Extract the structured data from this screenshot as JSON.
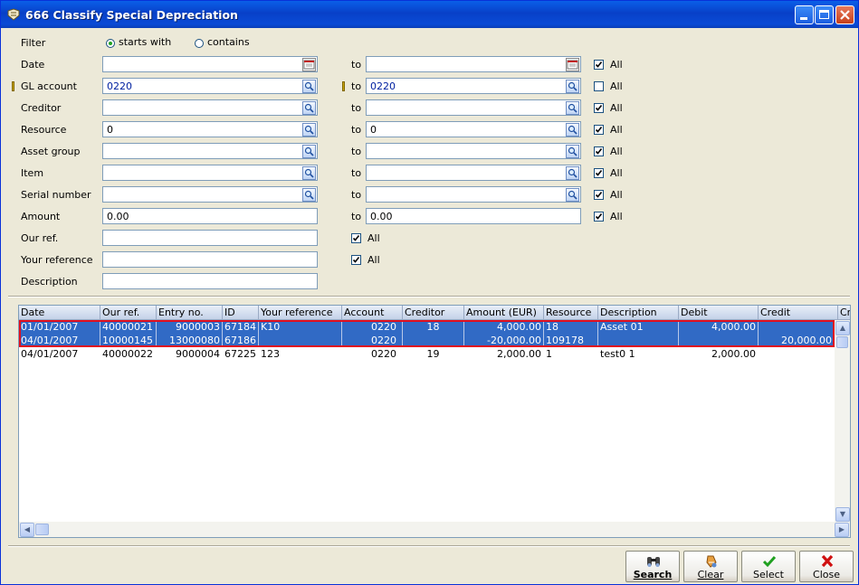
{
  "window": {
    "title": "666 Classify Special Depreciation"
  },
  "filter": {
    "label": "Filter",
    "option_starts_with": "starts with",
    "option_contains": "contains",
    "selected": "starts with"
  },
  "fields": {
    "to_label": "to",
    "all_label": "All",
    "date": {
      "label": "Date",
      "from": "",
      "to": "",
      "all": true
    },
    "gl_account": {
      "label": "GL account",
      "from": "0220",
      "to": "0220",
      "all": false
    },
    "creditor": {
      "label": "Creditor",
      "from": "",
      "to": "",
      "all": true
    },
    "resource": {
      "label": "Resource",
      "from": "0",
      "to": "0",
      "all": true
    },
    "asset_group": {
      "label": "Asset group",
      "from": "",
      "to": "",
      "all": true
    },
    "item": {
      "label": "Item",
      "from": "",
      "to": "",
      "all": true
    },
    "serial_number": {
      "label": "Serial number",
      "from": "",
      "to": "",
      "all": true
    },
    "amount": {
      "label": "Amount",
      "from": "0.00",
      "to": "0.00",
      "all": true
    },
    "our_ref": {
      "label": "Our ref.",
      "value": "",
      "all": true
    },
    "your_reference": {
      "label": "Your reference",
      "value": "",
      "all": true
    },
    "description": {
      "label": "Description",
      "value": ""
    }
  },
  "grid": {
    "columns": [
      "Date",
      "Our ref.",
      "Entry no.",
      "ID",
      "Your reference",
      "Account",
      "Creditor",
      "Amount (EUR)",
      "Resource",
      "Description",
      "Debit",
      "Credit",
      "Cr"
    ],
    "rows": [
      {
        "selected": true,
        "cells": [
          "01/01/2007",
          "40000021",
          "9000003",
          "67184",
          "K10",
          "0220",
          "18",
          "4,000.00",
          "18",
          "Asset 01",
          "4,000.00",
          ""
        ]
      },
      {
        "selected": true,
        "cells": [
          "04/01/2007",
          "10000145",
          "13000080",
          "67186",
          "",
          "0220",
          "",
          "-20,000.00",
          "109178",
          "",
          "",
          "20,000.00"
        ]
      },
      {
        "selected": false,
        "cells": [
          "04/01/2007",
          "40000022",
          "9000004",
          "67225",
          "123",
          "0220",
          "19",
          "2,000.00",
          "1",
          "test0 1",
          "2,000.00",
          ""
        ]
      }
    ]
  },
  "actions": {
    "search": {
      "label": "Search",
      "icon": "binoculars-icon"
    },
    "clear": {
      "label": "Clear",
      "icon": "eraser-icon"
    },
    "select": {
      "label": "Select",
      "icon": "checkmark-icon"
    },
    "close": {
      "label": "Close",
      "icon": "close-x-icon"
    }
  },
  "colors": {
    "selection": "#316AC5",
    "highlight_border": "#E01020",
    "titlebar": "#0A4BD6"
  }
}
